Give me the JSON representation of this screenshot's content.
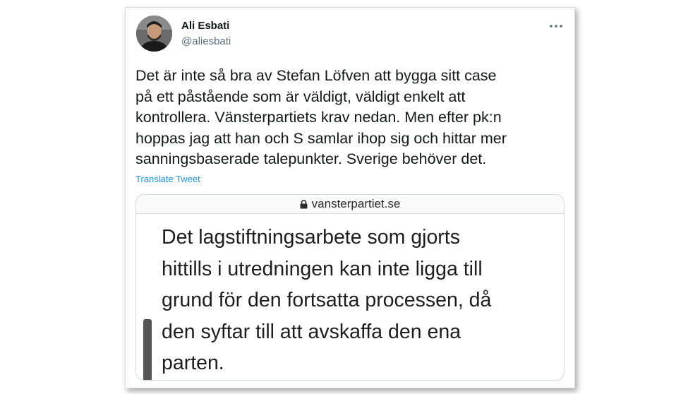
{
  "tweet": {
    "author_name": "Ali Esbati",
    "author_handle": "@aliesbati",
    "more_icon": "ellipsis-horizontal-icon",
    "text": "Det är inte så bra av Stefan Löfven att bygga sitt case\npå ett påstående som är väldigt, väldigt enkelt att\nkontrollera. Vänsterpartiets krav nedan. Men efter pk:n\nhoppas jag att han och S samlar ihop sig och hittar mer\nsanningsbaserade talepunkter. Sverige behöver det.",
    "translate_label": "Translate Tweet",
    "link_color": "#1b95e0"
  },
  "media": {
    "url": "vansterpartiet.se",
    "lock_icon": "lock-icon",
    "quote": "Det lagstiftningsarbete som gjorts\nhittills i utredningen kan inte ligga till\ngrund för den fortsatta processen, då\nden syftar till att avskaffa den ena\nparten."
  }
}
